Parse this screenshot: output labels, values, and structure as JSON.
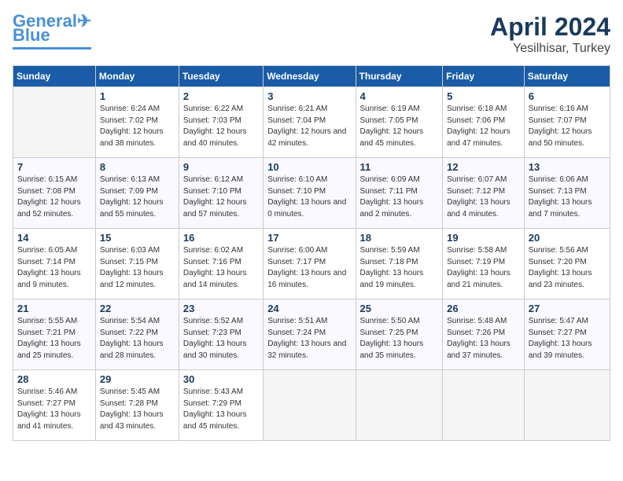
{
  "header": {
    "logo_line1": "General",
    "logo_line2": "Blue",
    "month_year": "April 2024",
    "location": "Yesilhisar, Turkey"
  },
  "days_of_week": [
    "Sunday",
    "Monday",
    "Tuesday",
    "Wednesday",
    "Thursday",
    "Friday",
    "Saturday"
  ],
  "weeks": [
    [
      {
        "day": "",
        "sunrise": "",
        "sunset": "",
        "daylight": ""
      },
      {
        "day": "1",
        "sunrise": "Sunrise: 6:24 AM",
        "sunset": "Sunset: 7:02 PM",
        "daylight": "Daylight: 12 hours and 38 minutes."
      },
      {
        "day": "2",
        "sunrise": "Sunrise: 6:22 AM",
        "sunset": "Sunset: 7:03 PM",
        "daylight": "Daylight: 12 hours and 40 minutes."
      },
      {
        "day": "3",
        "sunrise": "Sunrise: 6:21 AM",
        "sunset": "Sunset: 7:04 PM",
        "daylight": "Daylight: 12 hours and 42 minutes."
      },
      {
        "day": "4",
        "sunrise": "Sunrise: 6:19 AM",
        "sunset": "Sunset: 7:05 PM",
        "daylight": "Daylight: 12 hours and 45 minutes."
      },
      {
        "day": "5",
        "sunrise": "Sunrise: 6:18 AM",
        "sunset": "Sunset: 7:06 PM",
        "daylight": "Daylight: 12 hours and 47 minutes."
      },
      {
        "day": "6",
        "sunrise": "Sunrise: 6:16 AM",
        "sunset": "Sunset: 7:07 PM",
        "daylight": "Daylight: 12 hours and 50 minutes."
      }
    ],
    [
      {
        "day": "7",
        "sunrise": "Sunrise: 6:15 AM",
        "sunset": "Sunset: 7:08 PM",
        "daylight": "Daylight: 12 hours and 52 minutes."
      },
      {
        "day": "8",
        "sunrise": "Sunrise: 6:13 AM",
        "sunset": "Sunset: 7:09 PM",
        "daylight": "Daylight: 12 hours and 55 minutes."
      },
      {
        "day": "9",
        "sunrise": "Sunrise: 6:12 AM",
        "sunset": "Sunset: 7:10 PM",
        "daylight": "Daylight: 12 hours and 57 minutes."
      },
      {
        "day": "10",
        "sunrise": "Sunrise: 6:10 AM",
        "sunset": "Sunset: 7:10 PM",
        "daylight": "Daylight: 13 hours and 0 minutes."
      },
      {
        "day": "11",
        "sunrise": "Sunrise: 6:09 AM",
        "sunset": "Sunset: 7:11 PM",
        "daylight": "Daylight: 13 hours and 2 minutes."
      },
      {
        "day": "12",
        "sunrise": "Sunrise: 6:07 AM",
        "sunset": "Sunset: 7:12 PM",
        "daylight": "Daylight: 13 hours and 4 minutes."
      },
      {
        "day": "13",
        "sunrise": "Sunrise: 6:06 AM",
        "sunset": "Sunset: 7:13 PM",
        "daylight": "Daylight: 13 hours and 7 minutes."
      }
    ],
    [
      {
        "day": "14",
        "sunrise": "Sunrise: 6:05 AM",
        "sunset": "Sunset: 7:14 PM",
        "daylight": "Daylight: 13 hours and 9 minutes."
      },
      {
        "day": "15",
        "sunrise": "Sunrise: 6:03 AM",
        "sunset": "Sunset: 7:15 PM",
        "daylight": "Daylight: 13 hours and 12 minutes."
      },
      {
        "day": "16",
        "sunrise": "Sunrise: 6:02 AM",
        "sunset": "Sunset: 7:16 PM",
        "daylight": "Daylight: 13 hours and 14 minutes."
      },
      {
        "day": "17",
        "sunrise": "Sunrise: 6:00 AM",
        "sunset": "Sunset: 7:17 PM",
        "daylight": "Daylight: 13 hours and 16 minutes."
      },
      {
        "day": "18",
        "sunrise": "Sunrise: 5:59 AM",
        "sunset": "Sunset: 7:18 PM",
        "daylight": "Daylight: 13 hours and 19 minutes."
      },
      {
        "day": "19",
        "sunrise": "Sunrise: 5:58 AM",
        "sunset": "Sunset: 7:19 PM",
        "daylight": "Daylight: 13 hours and 21 minutes."
      },
      {
        "day": "20",
        "sunrise": "Sunrise: 5:56 AM",
        "sunset": "Sunset: 7:20 PM",
        "daylight": "Daylight: 13 hours and 23 minutes."
      }
    ],
    [
      {
        "day": "21",
        "sunrise": "Sunrise: 5:55 AM",
        "sunset": "Sunset: 7:21 PM",
        "daylight": "Daylight: 13 hours and 25 minutes."
      },
      {
        "day": "22",
        "sunrise": "Sunrise: 5:54 AM",
        "sunset": "Sunset: 7:22 PM",
        "daylight": "Daylight: 13 hours and 28 minutes."
      },
      {
        "day": "23",
        "sunrise": "Sunrise: 5:52 AM",
        "sunset": "Sunset: 7:23 PM",
        "daylight": "Daylight: 13 hours and 30 minutes."
      },
      {
        "day": "24",
        "sunrise": "Sunrise: 5:51 AM",
        "sunset": "Sunset: 7:24 PM",
        "daylight": "Daylight: 13 hours and 32 minutes."
      },
      {
        "day": "25",
        "sunrise": "Sunrise: 5:50 AM",
        "sunset": "Sunset: 7:25 PM",
        "daylight": "Daylight: 13 hours and 35 minutes."
      },
      {
        "day": "26",
        "sunrise": "Sunrise: 5:48 AM",
        "sunset": "Sunset: 7:26 PM",
        "daylight": "Daylight: 13 hours and 37 minutes."
      },
      {
        "day": "27",
        "sunrise": "Sunrise: 5:47 AM",
        "sunset": "Sunset: 7:27 PM",
        "daylight": "Daylight: 13 hours and 39 minutes."
      }
    ],
    [
      {
        "day": "28",
        "sunrise": "Sunrise: 5:46 AM",
        "sunset": "Sunset: 7:27 PM",
        "daylight": "Daylight: 13 hours and 41 minutes."
      },
      {
        "day": "29",
        "sunrise": "Sunrise: 5:45 AM",
        "sunset": "Sunset: 7:28 PM",
        "daylight": "Daylight: 13 hours and 43 minutes."
      },
      {
        "day": "30",
        "sunrise": "Sunrise: 5:43 AM",
        "sunset": "Sunset: 7:29 PM",
        "daylight": "Daylight: 13 hours and 45 minutes."
      },
      {
        "day": "",
        "sunrise": "",
        "sunset": "",
        "daylight": ""
      },
      {
        "day": "",
        "sunrise": "",
        "sunset": "",
        "daylight": ""
      },
      {
        "day": "",
        "sunrise": "",
        "sunset": "",
        "daylight": ""
      },
      {
        "day": "",
        "sunrise": "",
        "sunset": "",
        "daylight": ""
      }
    ]
  ]
}
